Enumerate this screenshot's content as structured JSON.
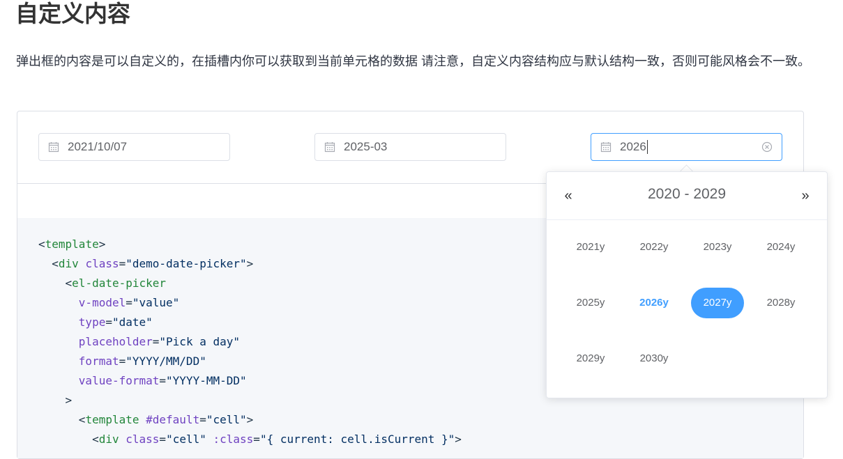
{
  "page": {
    "title": "自定义内容",
    "description": "弹出框的内容是可以自定义的，在插槽内你可以获取到当前单元格的数据 请注意，自定义内容结构应与默认结构一致，否则可能风格会不一致。"
  },
  "pickers": [
    {
      "value": "2021/10/07",
      "icon": "calendar-icon"
    },
    {
      "value": "2025-03",
      "icon": "calendar-icon"
    },
    {
      "value": "2026",
      "icon": "calendar-icon",
      "clear_icon": "circle-close-icon"
    }
  ],
  "code": {
    "lines": [
      [
        {
          "t": "<",
          "c": "punct"
        },
        {
          "t": "template",
          "c": "tag"
        },
        {
          "t": ">",
          "c": "punct"
        }
      ],
      [
        {
          "t": "  <",
          "c": "punct"
        },
        {
          "t": "div",
          "c": "tag"
        },
        {
          "t": " ",
          "c": "punct"
        },
        {
          "t": "class",
          "c": "attr"
        },
        {
          "t": "=",
          "c": "punct"
        },
        {
          "t": "\"demo-date-picker\"",
          "c": "str"
        },
        {
          "t": ">",
          "c": "punct"
        }
      ],
      [
        {
          "t": "    <",
          "c": "punct"
        },
        {
          "t": "el-date-picker",
          "c": "tag"
        }
      ],
      [
        {
          "t": "      ",
          "c": "punct"
        },
        {
          "t": "v-model",
          "c": "attr"
        },
        {
          "t": "=",
          "c": "punct"
        },
        {
          "t": "\"value\"",
          "c": "str"
        }
      ],
      [
        {
          "t": "      ",
          "c": "punct"
        },
        {
          "t": "type",
          "c": "attr"
        },
        {
          "t": "=",
          "c": "punct"
        },
        {
          "t": "\"date\"",
          "c": "str"
        }
      ],
      [
        {
          "t": "      ",
          "c": "punct"
        },
        {
          "t": "placeholder",
          "c": "attr"
        },
        {
          "t": "=",
          "c": "punct"
        },
        {
          "t": "\"Pick a day\"",
          "c": "str"
        }
      ],
      [
        {
          "t": "      ",
          "c": "punct"
        },
        {
          "t": "format",
          "c": "attr"
        },
        {
          "t": "=",
          "c": "punct"
        },
        {
          "t": "\"YYYY/MM/DD\"",
          "c": "str"
        }
      ],
      [
        {
          "t": "      ",
          "c": "punct"
        },
        {
          "t": "value-format",
          "c": "attr"
        },
        {
          "t": "=",
          "c": "punct"
        },
        {
          "t": "\"YYYY-MM-DD\"",
          "c": "str"
        }
      ],
      [
        {
          "t": "    >",
          "c": "punct"
        }
      ],
      [
        {
          "t": "      <",
          "c": "punct"
        },
        {
          "t": "template",
          "c": "tag"
        },
        {
          "t": " ",
          "c": "punct"
        },
        {
          "t": "#default",
          "c": "attr"
        },
        {
          "t": "=",
          "c": "punct"
        },
        {
          "t": "\"cell\"",
          "c": "str"
        },
        {
          "t": ">",
          "c": "punct"
        }
      ],
      [
        {
          "t": "        <",
          "c": "punct"
        },
        {
          "t": "div",
          "c": "tag"
        },
        {
          "t": " ",
          "c": "punct"
        },
        {
          "t": "class",
          "c": "attr"
        },
        {
          "t": "=",
          "c": "punct"
        },
        {
          "t": "\"cell\"",
          "c": "str"
        },
        {
          "t": " ",
          "c": "punct"
        },
        {
          "t": ":class",
          "c": "attr"
        },
        {
          "t": "=",
          "c": "punct"
        },
        {
          "t": "\"{ current: cell.isCurrent }\"",
          "c": "str"
        },
        {
          "t": ">",
          "c": "punct"
        }
      ]
    ]
  },
  "year_panel": {
    "prev_label": "«",
    "next_label": "»",
    "decade": "2020 - 2029",
    "years": [
      {
        "label": "2021y",
        "state": "normal"
      },
      {
        "label": "2022y",
        "state": "normal"
      },
      {
        "label": "2023y",
        "state": "normal"
      },
      {
        "label": "2024y",
        "state": "normal"
      },
      {
        "label": "2025y",
        "state": "normal"
      },
      {
        "label": "2026y",
        "state": "current"
      },
      {
        "label": "2027y",
        "state": "selected"
      },
      {
        "label": "2028y",
        "state": "normal"
      },
      {
        "label": "2029y",
        "state": "normal"
      },
      {
        "label": "2030y",
        "state": "normal"
      }
    ]
  },
  "colors": {
    "primary": "#409eff",
    "border": "#dcdfe6",
    "code_bg": "#f5f7fa"
  }
}
